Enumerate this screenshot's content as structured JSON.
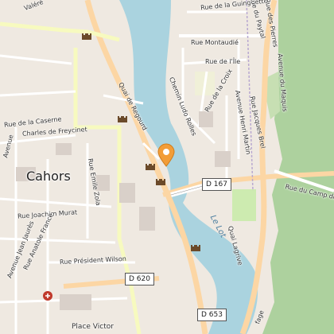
{
  "map": {
    "city": "Cahors",
    "river": "Le Lot",
    "streets": [
      "Rue de la Guinguette",
      "Rue du Paytal",
      "Rue Montaudié",
      "Rue de l'Île",
      "Avenue du Maquis",
      "Chemin Ludo Rolles",
      "Quai de Regourd",
      "Rue de la Caserne",
      "Charles de Freycinet",
      "Avenue Henri Martin",
      "Rue Jacques Brel",
      "Rue de la Croix",
      "Rue Emile Zola",
      "Rue Joachim Murat",
      "Rue Anatole France",
      "Avenue Jean Jaurès",
      "Rue du Camp de",
      "Quai Lagrive",
      "Rue Président Wilson",
      "Place Victor",
      "Rue des Pierres",
      "Valéré",
      "Avenue",
      "fage"
    ],
    "roads": [
      "D 167",
      "D 620",
      "D 653"
    ]
  },
  "colors": {
    "water": "#aad3df",
    "land": "#efe9e1",
    "park": "#cdebb0",
    "forest": "#add19e",
    "primary_road": "#fcd6a4",
    "secondary_road": "#f7fabf",
    "marker": "#f29d38"
  }
}
